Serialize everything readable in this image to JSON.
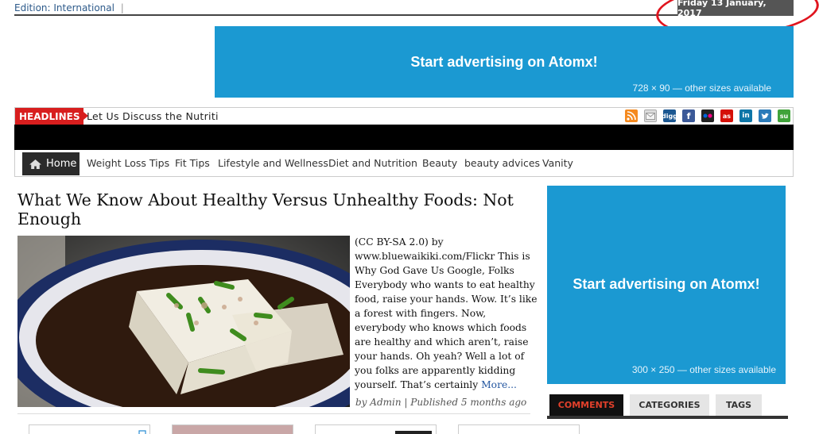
{
  "header": {
    "edition_label": "Edition: International",
    "separator": "|",
    "date": "Friday 13 January, 2017"
  },
  "ads": {
    "top": {
      "title": "Start advertising on Atomx!",
      "sizes": "728 × 90 — other sizes available"
    },
    "side": {
      "title": "Start advertising on Atomx!",
      "sizes": "300 × 250 — other sizes available"
    },
    "color": "#1b99d2"
  },
  "headlines": {
    "label": "HEADLINES",
    "ticker_text": "Let Us Discuss the Nutriti",
    "social_icons": [
      "rss-icon",
      "email-icon",
      "digg-icon",
      "facebook-icon",
      "flickr-icon",
      "lastfm-icon",
      "linkedin-icon",
      "twitter-icon",
      "stumbleupon-icon"
    ]
  },
  "nav": {
    "home": "Home",
    "items": [
      "Weight Loss Tips",
      "Fit Tips",
      "Lifestyle and Wellness",
      "Diet and Nutrition",
      "Beauty",
      "beauty advices",
      "Vanity"
    ]
  },
  "article": {
    "title": "What We Know About Healthy Versus Unhealthy Foods: Not Enough",
    "body": "(CC BY-SA 2.0) by www.bluewaikiki.com/Flickr This is Why God Gave Us Google, Folks Everybody who wants to eat healthy food, raise your hands. Wow. It’s like a forest with fingers. Now, everybody who knows which foods are healthy and which aren’t, raise your hands. Oh yeah? Well a lot of you folks are apparently kidding yourself. That’s certainly",
    "more_link": "More...",
    "meta": "by Admin | Published 5 months ago"
  },
  "sidebar_tabs": [
    "COMMENTS",
    "CATEGORIES",
    "TAGS"
  ],
  "colors": {
    "accent_red": "#d81e1e",
    "annotation_red": "#e0141e",
    "nav_dark": "#2b2b2b"
  }
}
